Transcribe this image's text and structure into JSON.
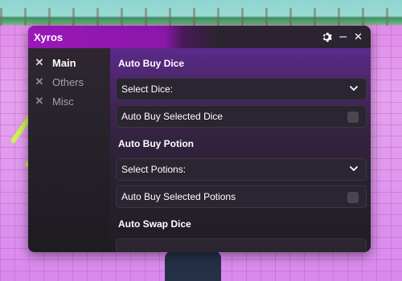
{
  "window": {
    "title": "Xyros",
    "settings_icon": "gear-icon",
    "minimize_glyph": "–",
    "close_glyph": "✕"
  },
  "sidebar": {
    "items": [
      {
        "label": "Main",
        "icon": "x-icon",
        "active": true
      },
      {
        "label": "Others",
        "icon": "x-icon",
        "active": false
      },
      {
        "label": "Misc",
        "icon": "x-icon",
        "active": false
      }
    ]
  },
  "main": {
    "sections": [
      {
        "title": "Auto Buy Dice",
        "dropdown": "Select Dice:",
        "toggle_label": "Auto Buy Selected Dice"
      },
      {
        "title": "Auto Buy Potion",
        "dropdown": "Select Potions:",
        "toggle_label": "Auto Buy Selected Potions"
      },
      {
        "title": "Auto Swap Dice"
      }
    ]
  },
  "colors": {
    "accent": "#9a18b8",
    "panel": "#232026",
    "field": "#2a2530"
  }
}
